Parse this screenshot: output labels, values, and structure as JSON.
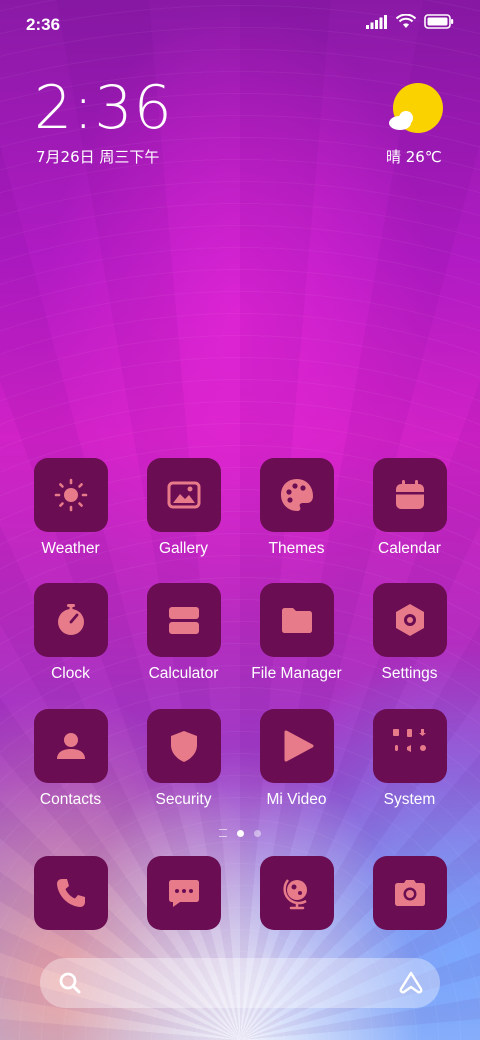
{
  "status_bar": {
    "time": "2:36",
    "icons": [
      "signal-icon",
      "wifi-icon",
      "battery-icon"
    ]
  },
  "lockscreen": {
    "clock": "2:36",
    "date": "7月26日 周三下午"
  },
  "weather": {
    "icon": "sunny-cloud-icon",
    "text": "晴 26℃"
  },
  "colors": {
    "tile_bg": "#6a0d52",
    "icon_fg": "#e77b8a",
    "sun": "#f9d200"
  },
  "apps": [
    {
      "label": "Weather",
      "icon": "sun-icon"
    },
    {
      "label": "Gallery",
      "icon": "gallery-icon"
    },
    {
      "label": "Themes",
      "icon": "palette-icon"
    },
    {
      "label": "Calendar",
      "icon": "calendar-icon"
    },
    {
      "label": "Clock",
      "icon": "stopwatch-icon"
    },
    {
      "label": "Calculator",
      "icon": "calculator-icon"
    },
    {
      "label": "File Manager",
      "icon": "folder-icon"
    },
    {
      "label": "Settings",
      "icon": "hexagon-gear-icon"
    },
    {
      "label": "Contacts",
      "icon": "person-icon"
    },
    {
      "label": "Security",
      "icon": "shield-icon"
    },
    {
      "label": "Mi Video",
      "icon": "play-icon"
    },
    {
      "label": "System",
      "icon": "folder-grid-icon"
    }
  ],
  "page_indicator": {
    "pages": 2,
    "current": 1
  },
  "dock": [
    {
      "icon": "phone-icon"
    },
    {
      "icon": "message-icon"
    },
    {
      "icon": "globe-icon"
    },
    {
      "icon": "camera-icon"
    }
  ],
  "search": {
    "left_icon": "search-icon",
    "right_icon": "assistant-icon"
  }
}
